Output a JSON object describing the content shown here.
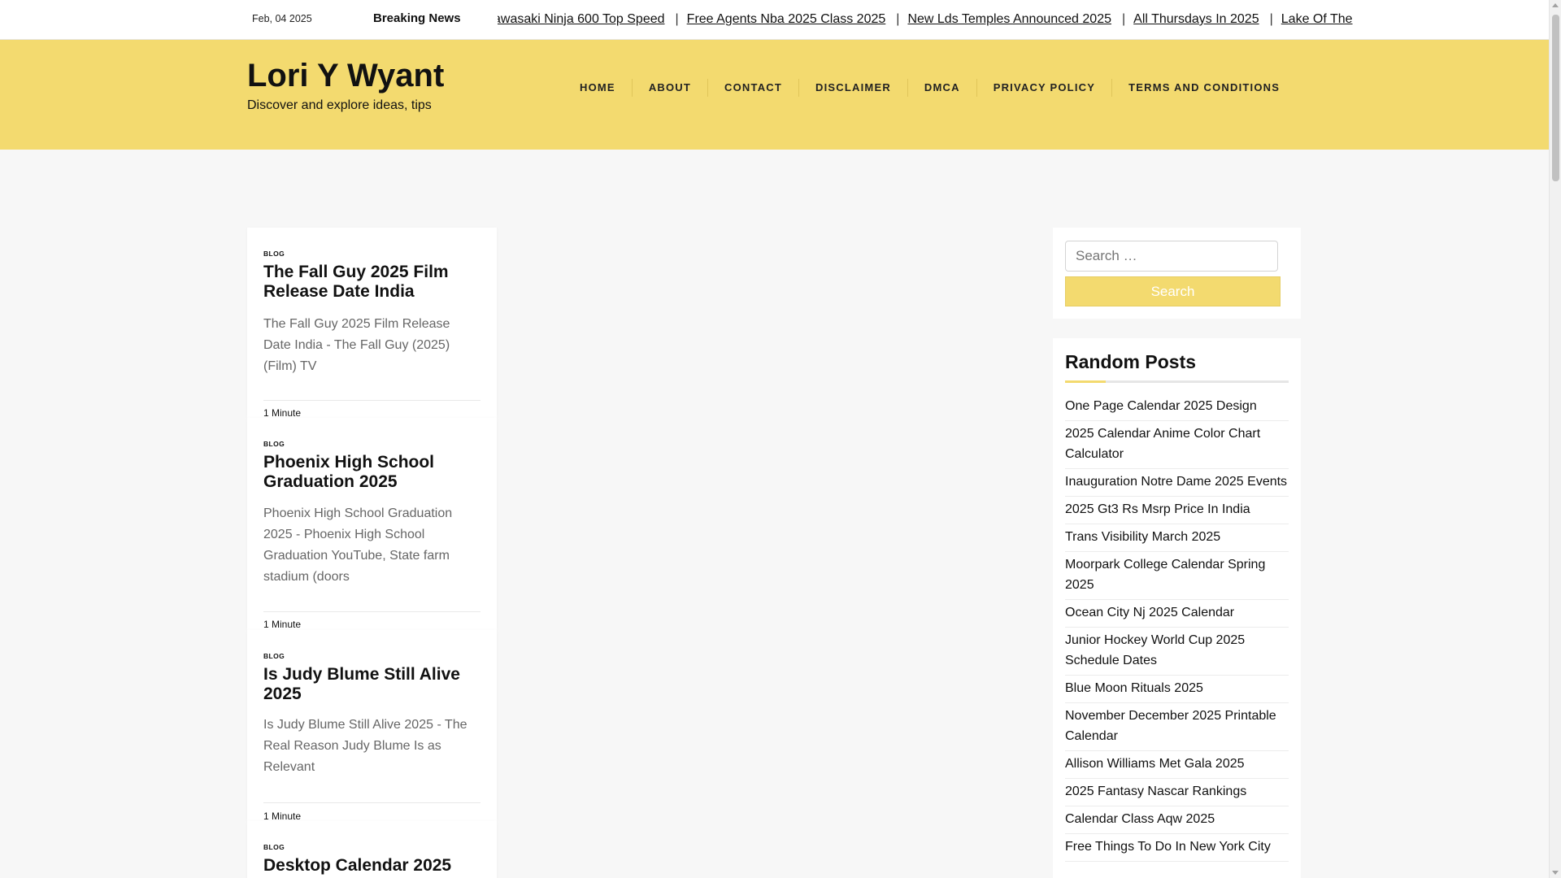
{
  "topbar": {
    "date": "Feb, 04 2025",
    "breaking_label": "Breaking News",
    "ticker": [
      "awasaki Ninja 600 Top Speed",
      "Free Agents Nba 2025 Class 2025",
      "New Lds Temples Announced 2025",
      "All Thursdays In 2025",
      "Lake Of The"
    ],
    "separator": "|"
  },
  "header": {
    "site_title": "Lori Y Wyant",
    "site_description": "Discover and explore ideas, tips",
    "background": "#f3da6f"
  },
  "nav": [
    "HOME",
    "ABOUT",
    "CONTACT",
    "DISCLAIMER",
    "DMCA",
    "PRIVACY POLICY",
    "TERMS AND CONDITIONS"
  ],
  "posts": [
    {
      "category": "BLOG",
      "title": "The Fall Guy 2025 Film Release Date India",
      "excerpt": "The Fall Guy 2025 Film Release Date India - The Fall Guy (2025) (Film) TV",
      "read_time": "1 Minute"
    },
    {
      "category": "BLOG",
      "title": "Phoenix High School Graduation 2025",
      "excerpt": "Phoenix High School Graduation 2025 - Phoenix High School Graduation YouTube, State farm stadium (doors",
      "read_time": "1 Minute"
    },
    {
      "category": "BLOG",
      "title": "Is Judy Blume Still Alive 2025",
      "excerpt": "Is Judy Blume Still Alive 2025 - The Real Reason Judy Blume Is as Relevant",
      "read_time": "1 Minute"
    },
    {
      "category": "BLOG",
      "title": "Desktop Calendar 2025"
    }
  ],
  "sidebar": {
    "search": {
      "placeholder": "Search …",
      "button_label": "Search"
    },
    "random_posts": {
      "title": "Random Posts",
      "items": [
        "One Page Calendar 2025 Design",
        "2025 Calendar Anime Color Chart Calculator",
        "Inauguration Notre Dame 2025 Events",
        "2025 Gt3 Rs Msrp Price In India",
        "Trans Visibility March 2025",
        "Moorpark College Calendar Spring 2025",
        "Ocean City Nj 2025 Calendar",
        "Junior Hockey World Cup 2025 Schedule Dates",
        "Blue Moon Rituals 2025",
        "November December 2025 Printable Calendar",
        "Allison Williams Met Gala 2025",
        "2025 Fantasy Nascar Rankings",
        "Calendar Class Aqw 2025",
        "Free Things To Do In New York City"
      ]
    }
  }
}
